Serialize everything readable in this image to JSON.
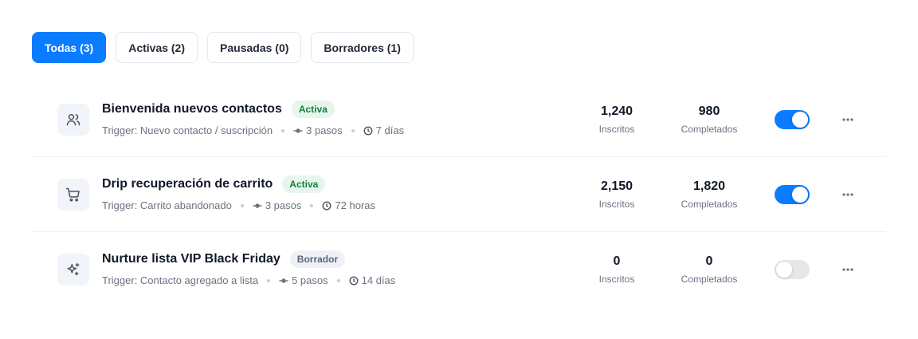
{
  "tabs": [
    {
      "label": "Todas (3)",
      "active": true
    },
    {
      "label": "Activas (2)",
      "active": false
    },
    {
      "label": "Pausadas (0)",
      "active": false
    },
    {
      "label": "Borradores (1)",
      "active": false
    }
  ],
  "colors": {
    "accent": "#0a7cff",
    "active_badge": "#15803d",
    "draft_badge": "#5b6576"
  },
  "sequences": [
    {
      "icon": "users-icon",
      "title": "Bienvenida nuevos contactos",
      "status": "Activa",
      "trigger": "Trigger: Nuevo contacto / suscripción",
      "steps": "3 pasos",
      "duration": "7 días",
      "enrolled": "1,240",
      "enrolled_label": "Inscritos",
      "completed": "980",
      "completed_label": "Completados",
      "enabled": true
    },
    {
      "icon": "cart-icon",
      "title": "Drip recuperación de carrito",
      "status": "Activa",
      "trigger": "Trigger: Carrito abandonado",
      "steps": "3 pasos",
      "duration": "72 horas",
      "enrolled": "2,150",
      "enrolled_label": "Inscritos",
      "completed": "1,820",
      "completed_label": "Completados",
      "enabled": true
    },
    {
      "icon": "sparkles-icon",
      "title": "Nurture lista VIP Black Friday",
      "status": "Borrador",
      "trigger": "Trigger: Contacto agregado a lista",
      "steps": "5 pasos",
      "duration": "14 días",
      "enrolled": "0",
      "enrolled_label": "Inscritos",
      "completed": "0",
      "completed_label": "Completados",
      "enabled": false
    }
  ]
}
